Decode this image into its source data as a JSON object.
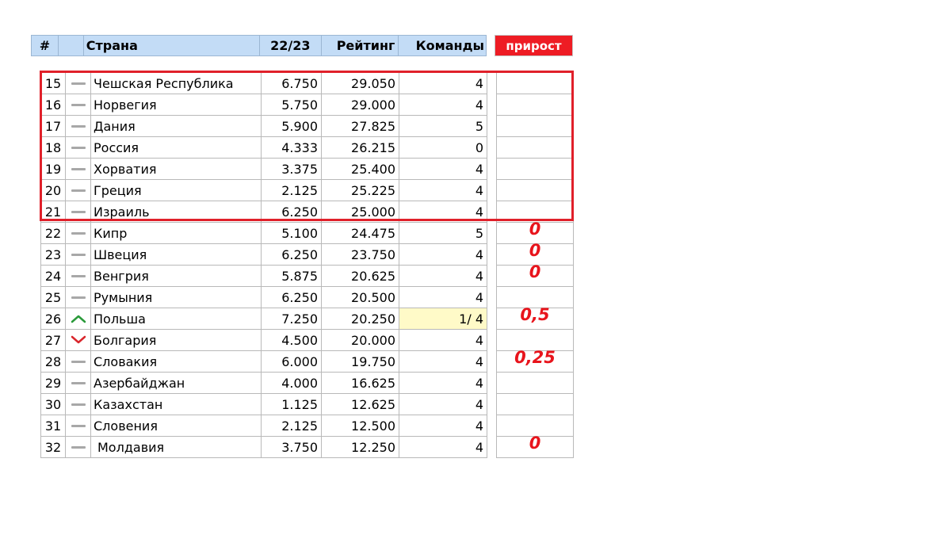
{
  "header": {
    "num": "#",
    "country": "Страна",
    "season": "22/23",
    "rating": "Рейтинг",
    "teams": "Команды",
    "growth": "прирост"
  },
  "colors": {
    "header_bg": "#c3dcf6",
    "growth_header_bg": "#ee1c24",
    "growth_value": "#e8141c",
    "highlight_box": "#e0202a",
    "up_arrow": "#2a9a3a",
    "down_arrow": "#d9262c",
    "teams_highlight": "#fffac8"
  },
  "rows": [
    {
      "num": "15",
      "trend": "none",
      "country": "Чешская Республика",
      "season": "6.750",
      "rating": "29.050",
      "teams": "4",
      "growth": ""
    },
    {
      "num": "16",
      "trend": "none",
      "country": "Норвегия",
      "season": "5.750",
      "rating": "29.000",
      "teams": "4",
      "growth": ""
    },
    {
      "num": "17",
      "trend": "none",
      "country": "Дания",
      "season": "5.900",
      "rating": "27.825",
      "teams": "5",
      "growth": ""
    },
    {
      "num": "18",
      "trend": "none",
      "country": "Россия",
      "season": "4.333",
      "rating": "26.215",
      "teams": "0",
      "growth": ""
    },
    {
      "num": "19",
      "trend": "none",
      "country": "Хорватия",
      "season": "3.375",
      "rating": "25.400",
      "teams": "4",
      "growth": ""
    },
    {
      "num": "20",
      "trend": "none",
      "country": "Греция",
      "season": "2.125",
      "rating": "25.225",
      "teams": "4",
      "growth": ""
    },
    {
      "num": "21",
      "trend": "none",
      "country": "Израиль",
      "season": "6.250",
      "rating": "25.000",
      "teams": "4",
      "growth": ""
    },
    {
      "num": "22",
      "trend": "none",
      "country": "Кипр",
      "season": "5.100",
      "rating": "24.475",
      "teams": "5",
      "growth": "0"
    },
    {
      "num": "23",
      "trend": "none",
      "country": "Швеция",
      "season": "6.250",
      "rating": "23.750",
      "teams": "4",
      "growth": "0"
    },
    {
      "num": "24",
      "trend": "none",
      "country": "Венгрия",
      "season": "5.875",
      "rating": "20.625",
      "teams": "4",
      "growth": "0"
    },
    {
      "num": "25",
      "trend": "none",
      "country": "Румыния",
      "season": "6.250",
      "rating": "20.500",
      "teams": "4",
      "growth": ""
    },
    {
      "num": "26",
      "trend": "up",
      "country": "Польша",
      "season": "7.250",
      "rating": "20.250",
      "teams": "1/ 4",
      "growth": "0,5",
      "teams_highlight": true
    },
    {
      "num": "27",
      "trend": "down",
      "country": "Болгария",
      "season": "4.500",
      "rating": "20.000",
      "teams": "4",
      "growth": ""
    },
    {
      "num": "28",
      "trend": "none",
      "country": "Словакия",
      "season": "6.000",
      "rating": "19.750",
      "teams": "4",
      "growth": "0,25"
    },
    {
      "num": "29",
      "trend": "none",
      "country": "Азербайджан",
      "season": "4.000",
      "rating": "16.625",
      "teams": "4",
      "growth": ""
    },
    {
      "num": "30",
      "trend": "none",
      "country": "Казахстан",
      "season": "1.125",
      "rating": "12.625",
      "teams": "4",
      "growth": ""
    },
    {
      "num": "31",
      "trend": "none",
      "country": "Словения",
      "season": "2.125",
      "rating": "12.500",
      "teams": "4",
      "growth": ""
    },
    {
      "num": "32",
      "trend": "none",
      "country": "Молдавия",
      "season": "3.750",
      "rating": "12.250",
      "teams": "4",
      "growth": "0",
      "indent": true
    }
  ]
}
